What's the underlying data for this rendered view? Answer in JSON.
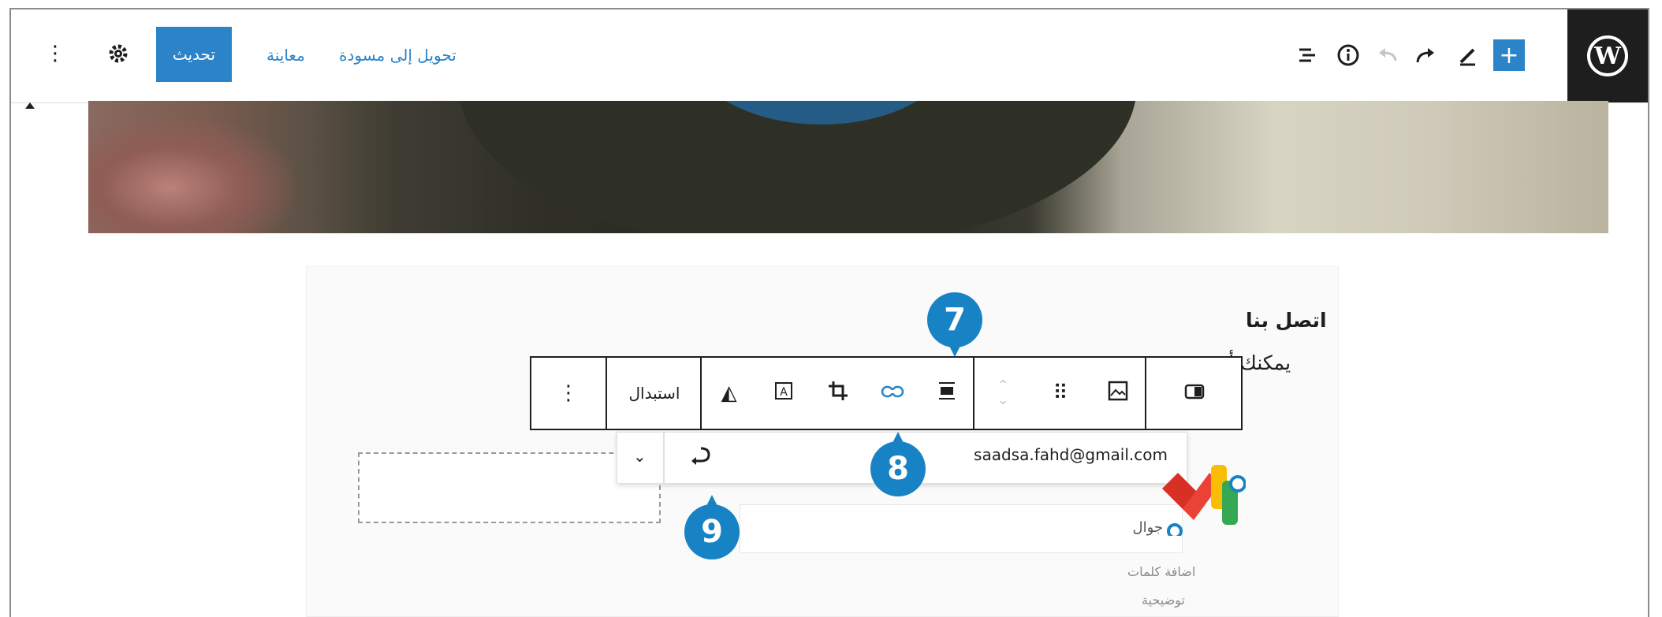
{
  "topbar": {
    "update_label": "تحديث",
    "preview_label": "معاينة",
    "switch_to_draft_label": "تحويل إلى مسودة",
    "icons": [
      "wordpress-icon",
      "add-block-icon",
      "edit-icon",
      "redo-icon",
      "undo-icon",
      "info-icon",
      "list-view-icon",
      "settings-icon",
      "more-options-icon"
    ]
  },
  "content": {
    "heading": "اتصل بنا",
    "paragraph_visible": "يمكنك أن"
  },
  "block_toolbar": {
    "replace_label": "استبدال",
    "icons": [
      "more-options-icon",
      "duotone-icon",
      "text-over-image-icon",
      "crop-icon",
      "link-icon",
      "align-icon",
      "move-arrows-icon",
      "drag-handle-icon",
      "image-block-icon",
      "transform-icon"
    ]
  },
  "link_popover": {
    "url": "saadsa.fahd@gmail.com",
    "icons": [
      "chevron-down-icon",
      "link-return-icon"
    ]
  },
  "form": {
    "field_label": "جوال"
  },
  "app_caption": {
    "line1": "اضافة كلمات",
    "line2": "توضيحية"
  },
  "badges": {
    "seven": "7",
    "eight": "8",
    "nine": "9"
  },
  "colors": {
    "accent": "#2b84c7",
    "badge": "#1883c4",
    "dark": "#1e1e1e"
  }
}
